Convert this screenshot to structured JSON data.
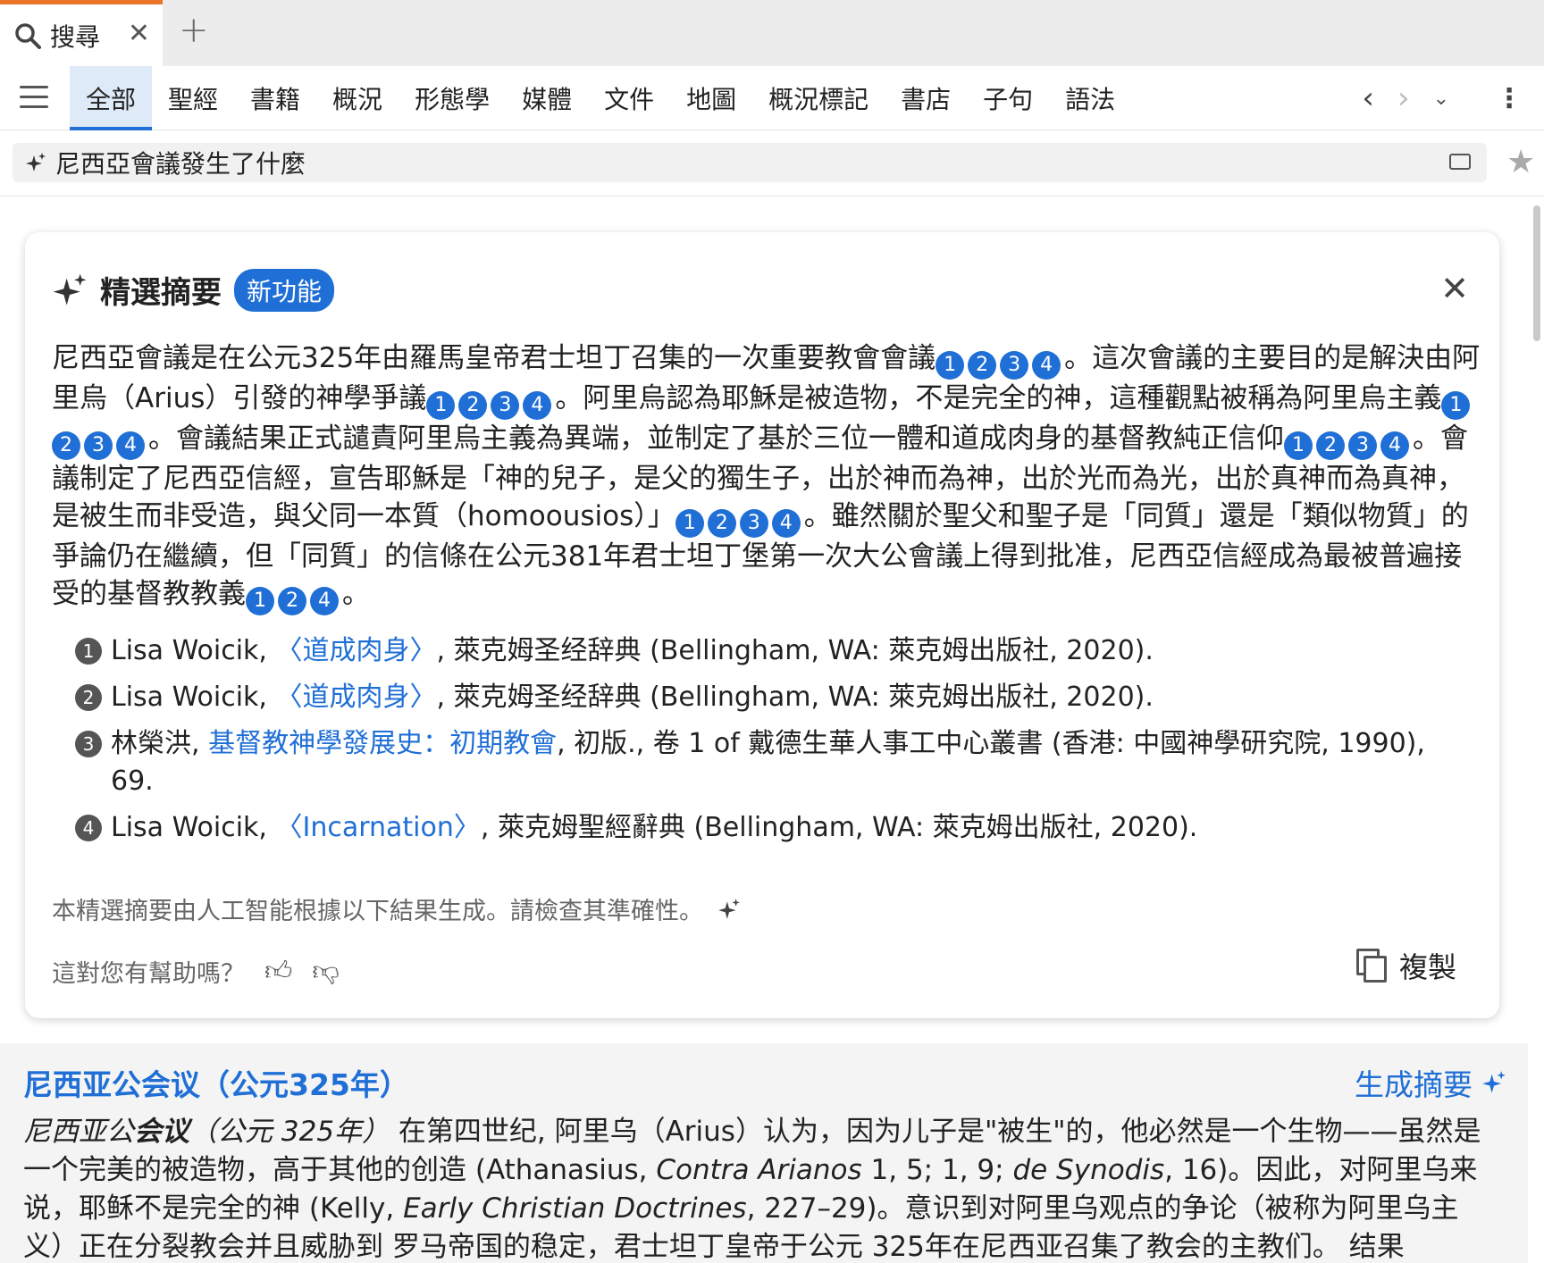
{
  "tabs": [
    {
      "title": "搜尋"
    }
  ],
  "categories": [
    "全部",
    "聖經",
    "書籍",
    "概況",
    "形態學",
    "媒體",
    "文件",
    "地圖",
    "概況標記",
    "書店",
    "子句",
    "語法"
  ],
  "active_category": "全部",
  "search": {
    "query": "尼西亞會議發生了什麼"
  },
  "summary": {
    "title": "精選摘要",
    "badge": "新功能",
    "paragraph": [
      {
        "text": "尼西亞會議是在公元325年由羅馬皇帝君士坦丁召集的一次重要教會會議",
        "cites": [
          "1",
          "2",
          "3",
          "4"
        ]
      },
      {
        "text": "。這次會議的主要目的是解決由阿里烏（Arius）引發的神學爭議",
        "cites": [
          "1",
          "2",
          "3",
          "4"
        ]
      },
      {
        "text": "。阿里烏認為耶穌是被造物，不是完全的神，這種觀點被稱為阿里烏主義",
        "cites": [
          "1",
          "2",
          "3",
          "4"
        ]
      },
      {
        "text": "。會議結果正式譴責阿里烏主義為異端，並制定了基於三位一體和道成肉身的基督教純正信仰",
        "cites": [
          "1",
          "2",
          "3",
          "4"
        ]
      },
      {
        "text": "。會議制定了尼西亞信經，宣告耶穌是「神的兒子，是父的獨生子，出於神而為神，出於光而為光，出於真神而為真神，是被生而非受造，與父同一本質（homoousios）」",
        "cites": [
          "1",
          "2",
          "3",
          "4"
        ]
      },
      {
        "text": "。雖然關於聖父和聖子是「同質」還是「類似物質」的爭論仍在繼續，但「同質」的信條在公元381年君士坦丁堡第一次大公會議上得到批准，尼西亞信經成為最被普遍接受的基督教教義",
        "cites": [
          "1",
          "2",
          "4"
        ]
      },
      {
        "text": "。",
        "cites": []
      }
    ],
    "references": [
      {
        "num": "1",
        "pre": "Lisa Woicik, ",
        "link": "〈道成肉身〉",
        "post": ", 萊克姆圣经辞典 (Bellingham, WA: 萊克姆出版社, 2020)."
      },
      {
        "num": "2",
        "pre": "Lisa Woicik, ",
        "link": "〈道成肉身〉",
        "post": ", 萊克姆圣经辞典 (Bellingham, WA: 萊克姆出版社, 2020)."
      },
      {
        "num": "3",
        "pre": "林榮洪, ",
        "link": "基督教神學發展史：初期教會",
        "post": ", 初版., 卷 1 of 戴德生華人事工中心叢書 (香港: 中國神學研究院, 1990), 69."
      },
      {
        "num": "4",
        "pre": "Lisa Woicik, ",
        "link": "〈Incarnation〉",
        "post": ", 萊克姆聖經辭典 (Bellingham, WA: 萊克姆出版社, 2020)."
      }
    ],
    "disclaimer": "本精選摘要由人工智能根據以下結果生成。請檢查其準確性。",
    "feedback_prompt": "這對您有幫助嗎？",
    "copy_label": "複製"
  },
  "result": {
    "title": "尼西亚公会议（公元325年）",
    "generate_label": "生成摘要",
    "body": [
      {
        "t": "尼西亚公",
        "i": true,
        "b": false
      },
      {
        "t": "会议",
        "i": true,
        "b": true
      },
      {
        "t": "（公元 325年）",
        "i": true,
        "b": false
      },
      {
        "t": " 在第四世纪, 阿里乌（Arius）认为，因为儿子是\"被生\"的，他必然是一个生物——虽然是一个完美的被造物，高于其他的创造 (Athanasius, ",
        "i": false,
        "b": false
      },
      {
        "t": "Contra Arianos",
        "i": true,
        "b": false
      },
      {
        "t": " 1, 5; 1, 9; ",
        "i": false,
        "b": false
      },
      {
        "t": "de Synodis",
        "i": true,
        "b": false
      },
      {
        "t": ", 16)。因此，对阿里乌来说，耶稣不是完全的神 (Kelly, ",
        "i": false,
        "b": false
      },
      {
        "t": "Early Christian Doctrines",
        "i": true,
        "b": false
      },
      {
        "t": ", 227–29)。意识到对阿里乌观点的争论（被称为阿里乌主义）正在分裂教会并且威胁到 罗马帝国的稳定，君士坦丁皇帝于公元 325年在尼西亚召集了教会的主教们。 结果",
        "i": false,
        "b": false
      }
    ]
  }
}
